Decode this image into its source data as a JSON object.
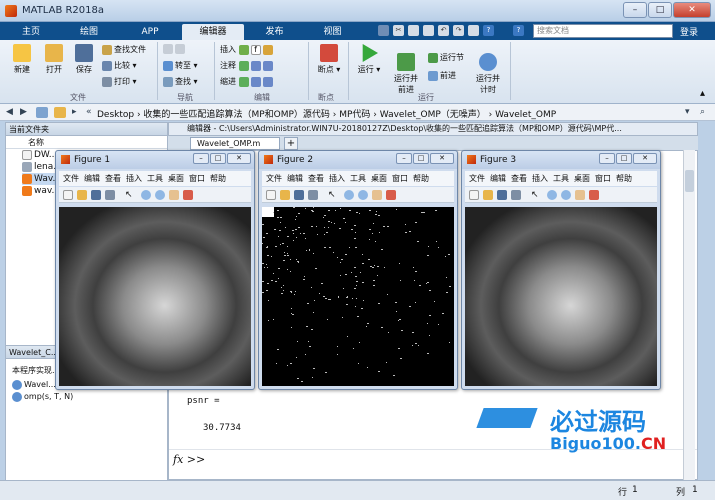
{
  "app": {
    "title": "MATLAB R2018a"
  },
  "tabs": [
    "主页",
    "绘图",
    "APP",
    "编辑器",
    "发布",
    "视图"
  ],
  "active_tab": "编辑器",
  "search": {
    "placeholder": "搜索文档"
  },
  "login": "登录",
  "ribbon": {
    "file": {
      "new": "新建",
      "open": "打开",
      "save": "保存",
      "find_files": "查找文件",
      "compare": "比较",
      "print": "打印",
      "group": "文件"
    },
    "nav": {
      "goto": "转至",
      "find": "查找",
      "group": "导航"
    },
    "edit": {
      "insert": "插入",
      "comment": "注释",
      "indent": "缩进",
      "group": "编辑"
    },
    "breakpoint": {
      "label": "断点",
      "group": "断点"
    },
    "run": {
      "run": "运行",
      "run_advance": "运行并\n前进",
      "run_section": "运行节",
      "advance": "前进",
      "run_time": "运行并\n计时",
      "group": "运行"
    }
  },
  "address": {
    "path": "Desktop › 收集的一些匹配追踪算法（MP和OMP）源代码 › MP代码 › Wavelet_OMP（无噪声） › Wavelet_OMP"
  },
  "current_folder": {
    "title": "当前文件夹",
    "col_name": "名称",
    "files": [
      "DW...",
      "lena...",
      "Wav...",
      "wav..."
    ]
  },
  "details": {
    "title": "Wavelet_C...",
    "desc": "本程序实现...",
    "items": [
      "Wavel...",
      "omp(s, T, N)"
    ]
  },
  "editor": {
    "header": "编辑器 - C:\\Users\\Administrator.WIN7U-20180127Z\\Desktop\\收集的一些匹配追踪算法（MP和OMP）源代码\\MP代...",
    "tab": "Wavelet_OMP.m",
    "add": "+"
  },
  "console": {
    "var": "psnr =",
    "value": "30.7734",
    "prompt": "fx >>"
  },
  "status": {
    "row_label": "行",
    "row": "1",
    "col_label": "列",
    "col": "1"
  },
  "figures": [
    {
      "title": "Figure 1",
      "type": "image"
    },
    {
      "title": "Figure 2",
      "type": "sparse"
    },
    {
      "title": "Figure 3",
      "type": "image"
    }
  ],
  "figure_menu": [
    "文件",
    "编辑",
    "查看",
    "插入",
    "工具",
    "桌面",
    "窗口",
    "帮助"
  ],
  "watermark": {
    "text_cn": "必过源码",
    "text_en": "Biguo100.",
    "text_cn_tld": "CN"
  },
  "colors": {
    "tabstrip": "#0f4f8c",
    "accent": "#1c86e0"
  }
}
